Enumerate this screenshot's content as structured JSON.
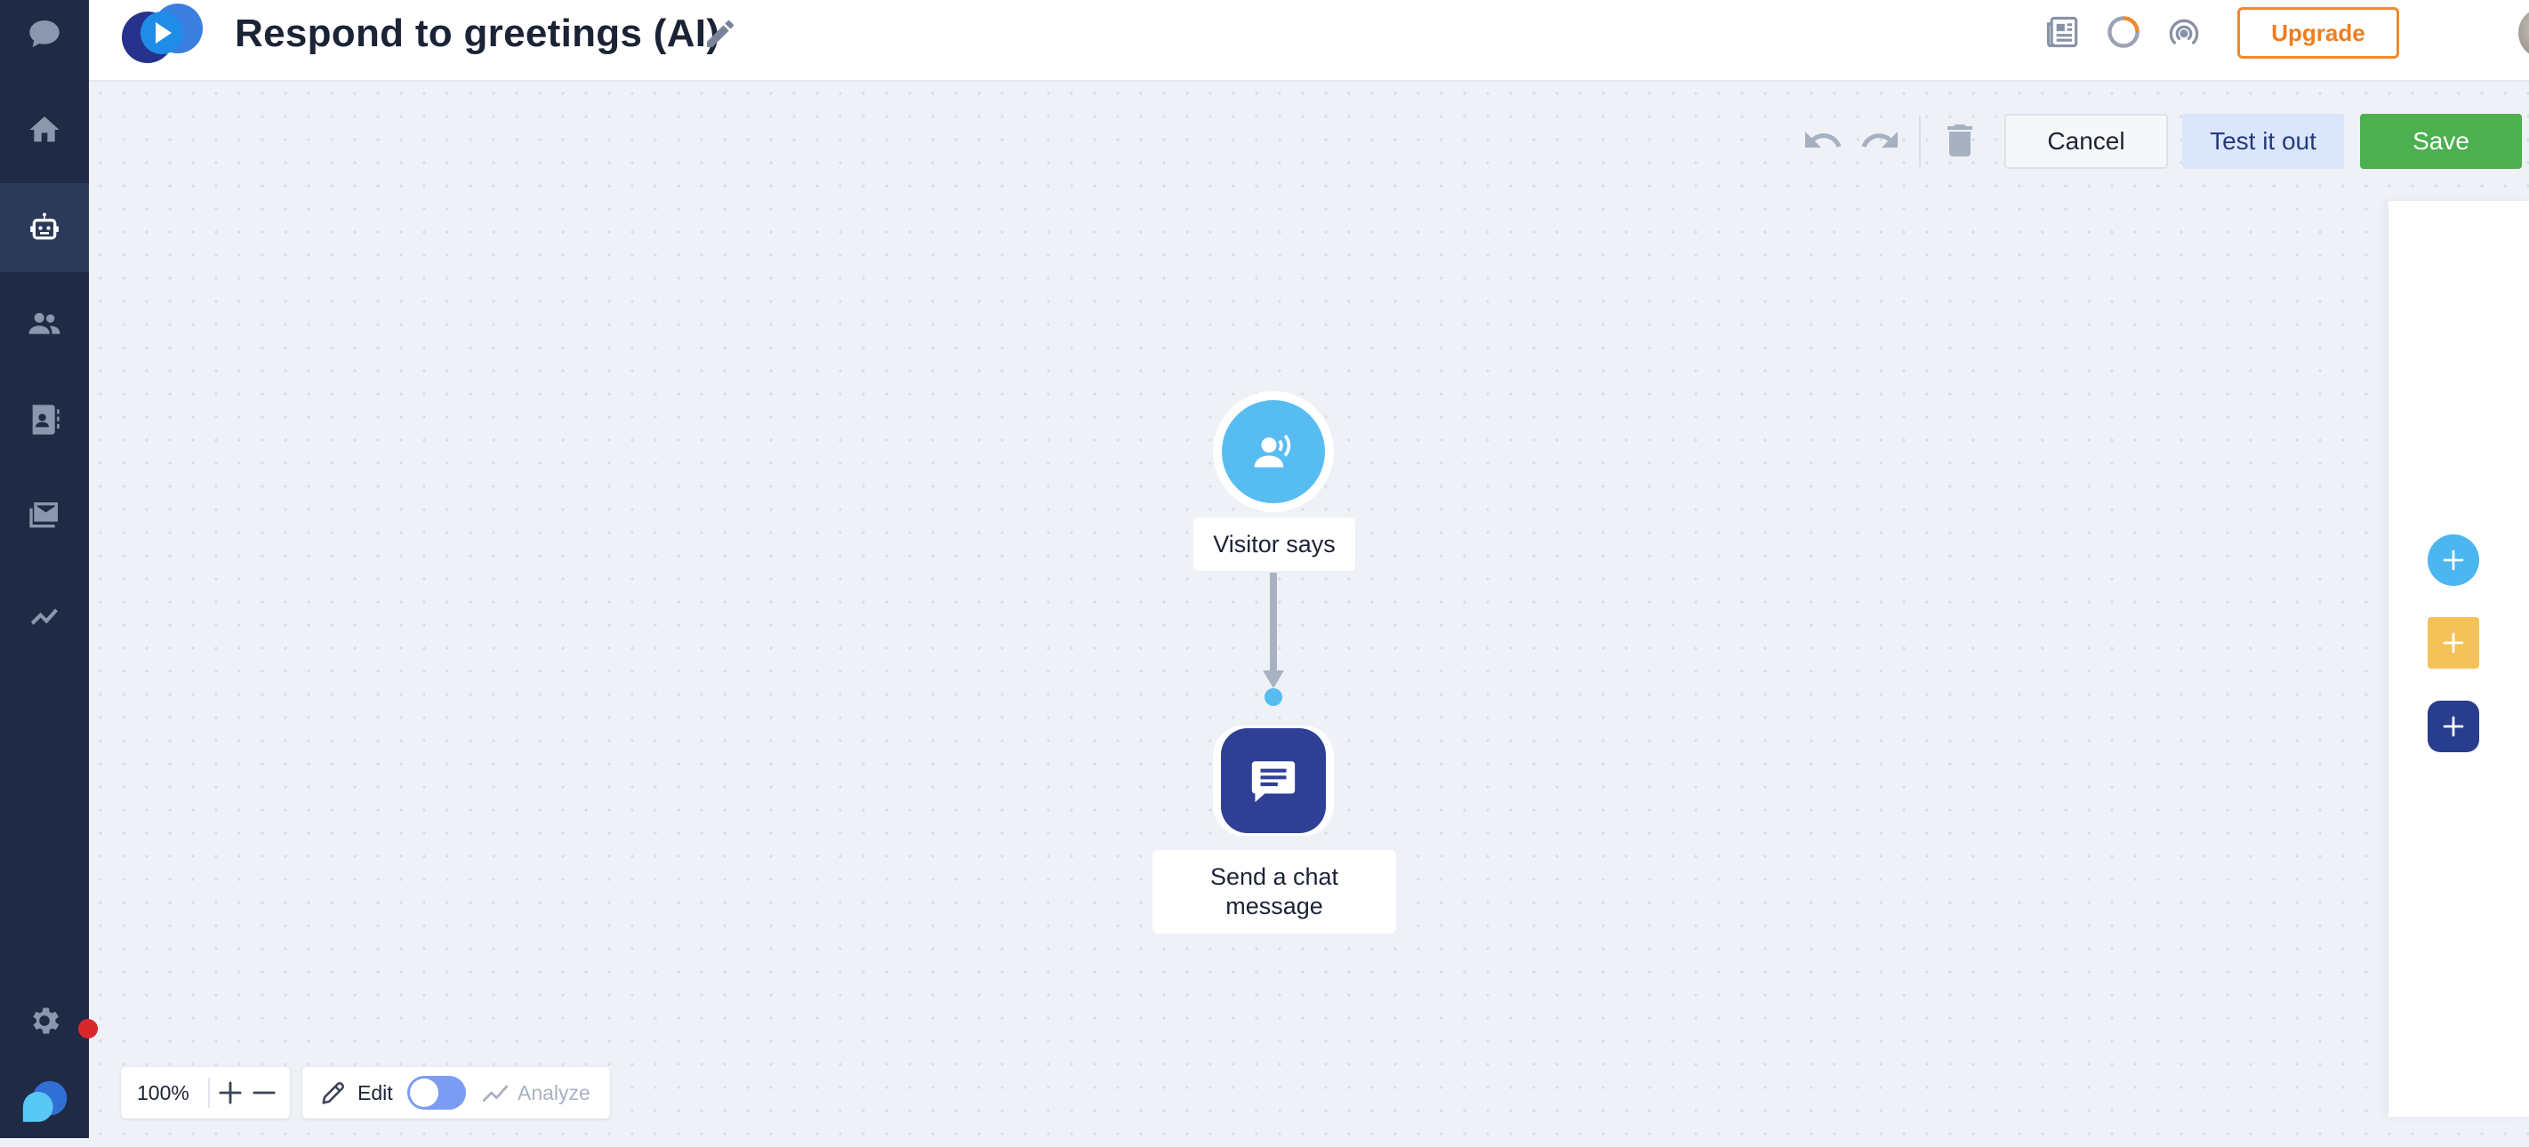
{
  "app": {
    "title": "Respond to greetings (AI)"
  },
  "sidebar": {
    "items": [
      {
        "name": "chat-icon",
        "active": false
      },
      {
        "name": "home-icon",
        "active": false
      },
      {
        "name": "bot-icon",
        "active": true
      },
      {
        "name": "team-icon",
        "active": false
      },
      {
        "name": "contacts-icon",
        "active": false
      },
      {
        "name": "mail-icon",
        "active": false
      },
      {
        "name": "analytics-icon",
        "active": false
      },
      {
        "name": "gear-icon",
        "active": false
      },
      {
        "name": "brand-logo-icon",
        "active": false
      }
    ]
  },
  "header": {
    "upgrade_label": "Upgrade",
    "icons": [
      "news-icon",
      "progress-ring-icon",
      "broadcast-icon"
    ]
  },
  "toolbar": {
    "cancel_label": "Cancel",
    "test_label": "Test it out",
    "save_label": "Save"
  },
  "flow": {
    "nodes": [
      {
        "label": "Visitor says",
        "icon": "visitor-speaking-icon"
      },
      {
        "label": "Send a chat message",
        "icon": "chat-message-icon"
      }
    ]
  },
  "bottom": {
    "zoom": "100%",
    "edit_label": "Edit",
    "analyze_label": "Analyze",
    "edit_mode_on": true
  },
  "colors": {
    "sidebar": "#1f2a44",
    "save": "#4caf50",
    "upgrade": "#ef7d1e",
    "trigger_node": "#57bdf0",
    "action_node": "#2e3f95",
    "condition_add": "#f5c25a"
  }
}
